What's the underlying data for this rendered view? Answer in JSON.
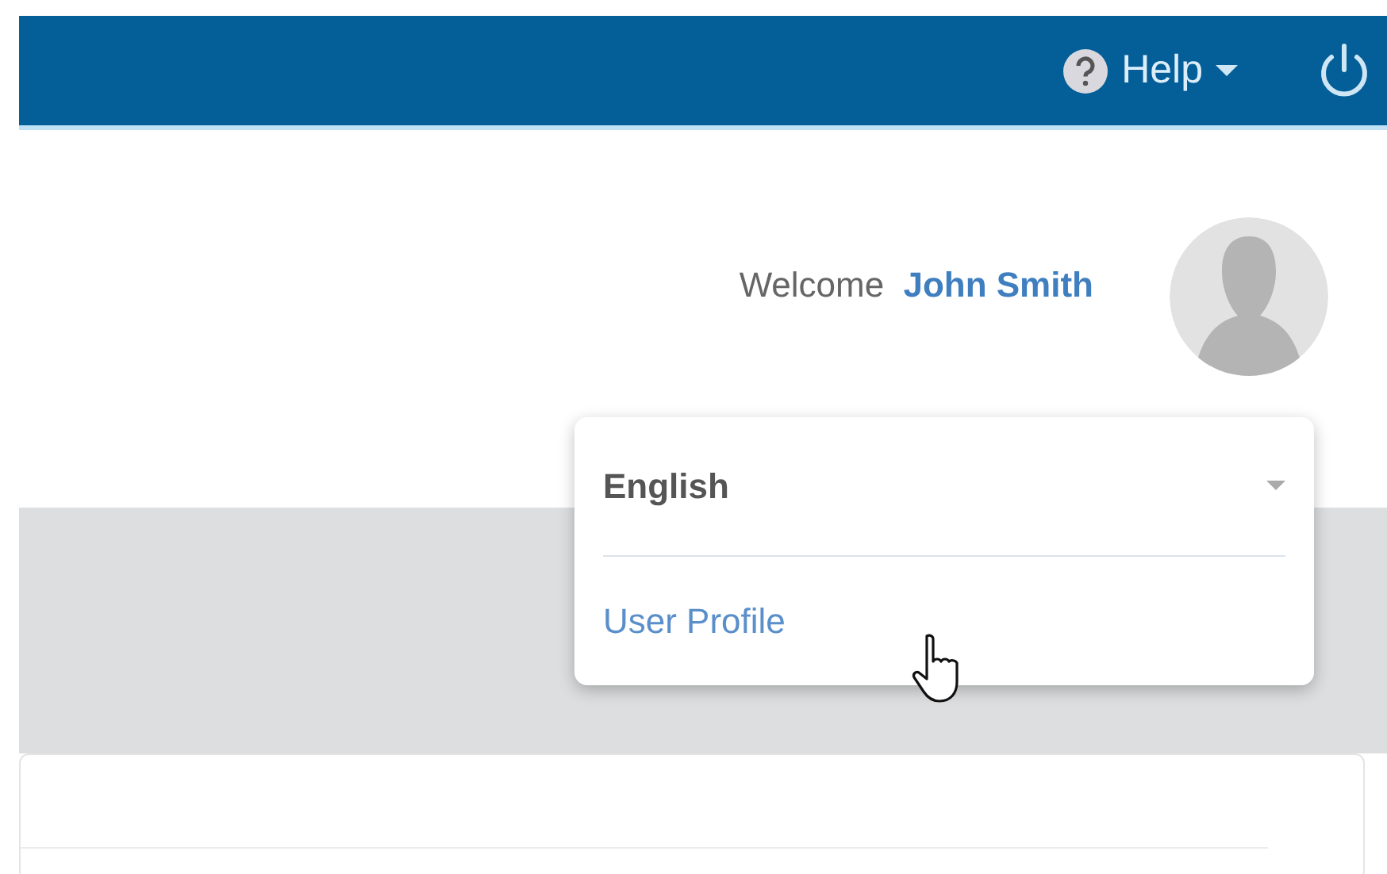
{
  "header": {
    "help": {
      "label": "Help"
    }
  },
  "welcome": {
    "greeting": "Welcome",
    "user": "John Smith"
  },
  "user_menu": {
    "language": {
      "value": "English"
    },
    "items": [
      {
        "label": "User Profile"
      }
    ]
  }
}
